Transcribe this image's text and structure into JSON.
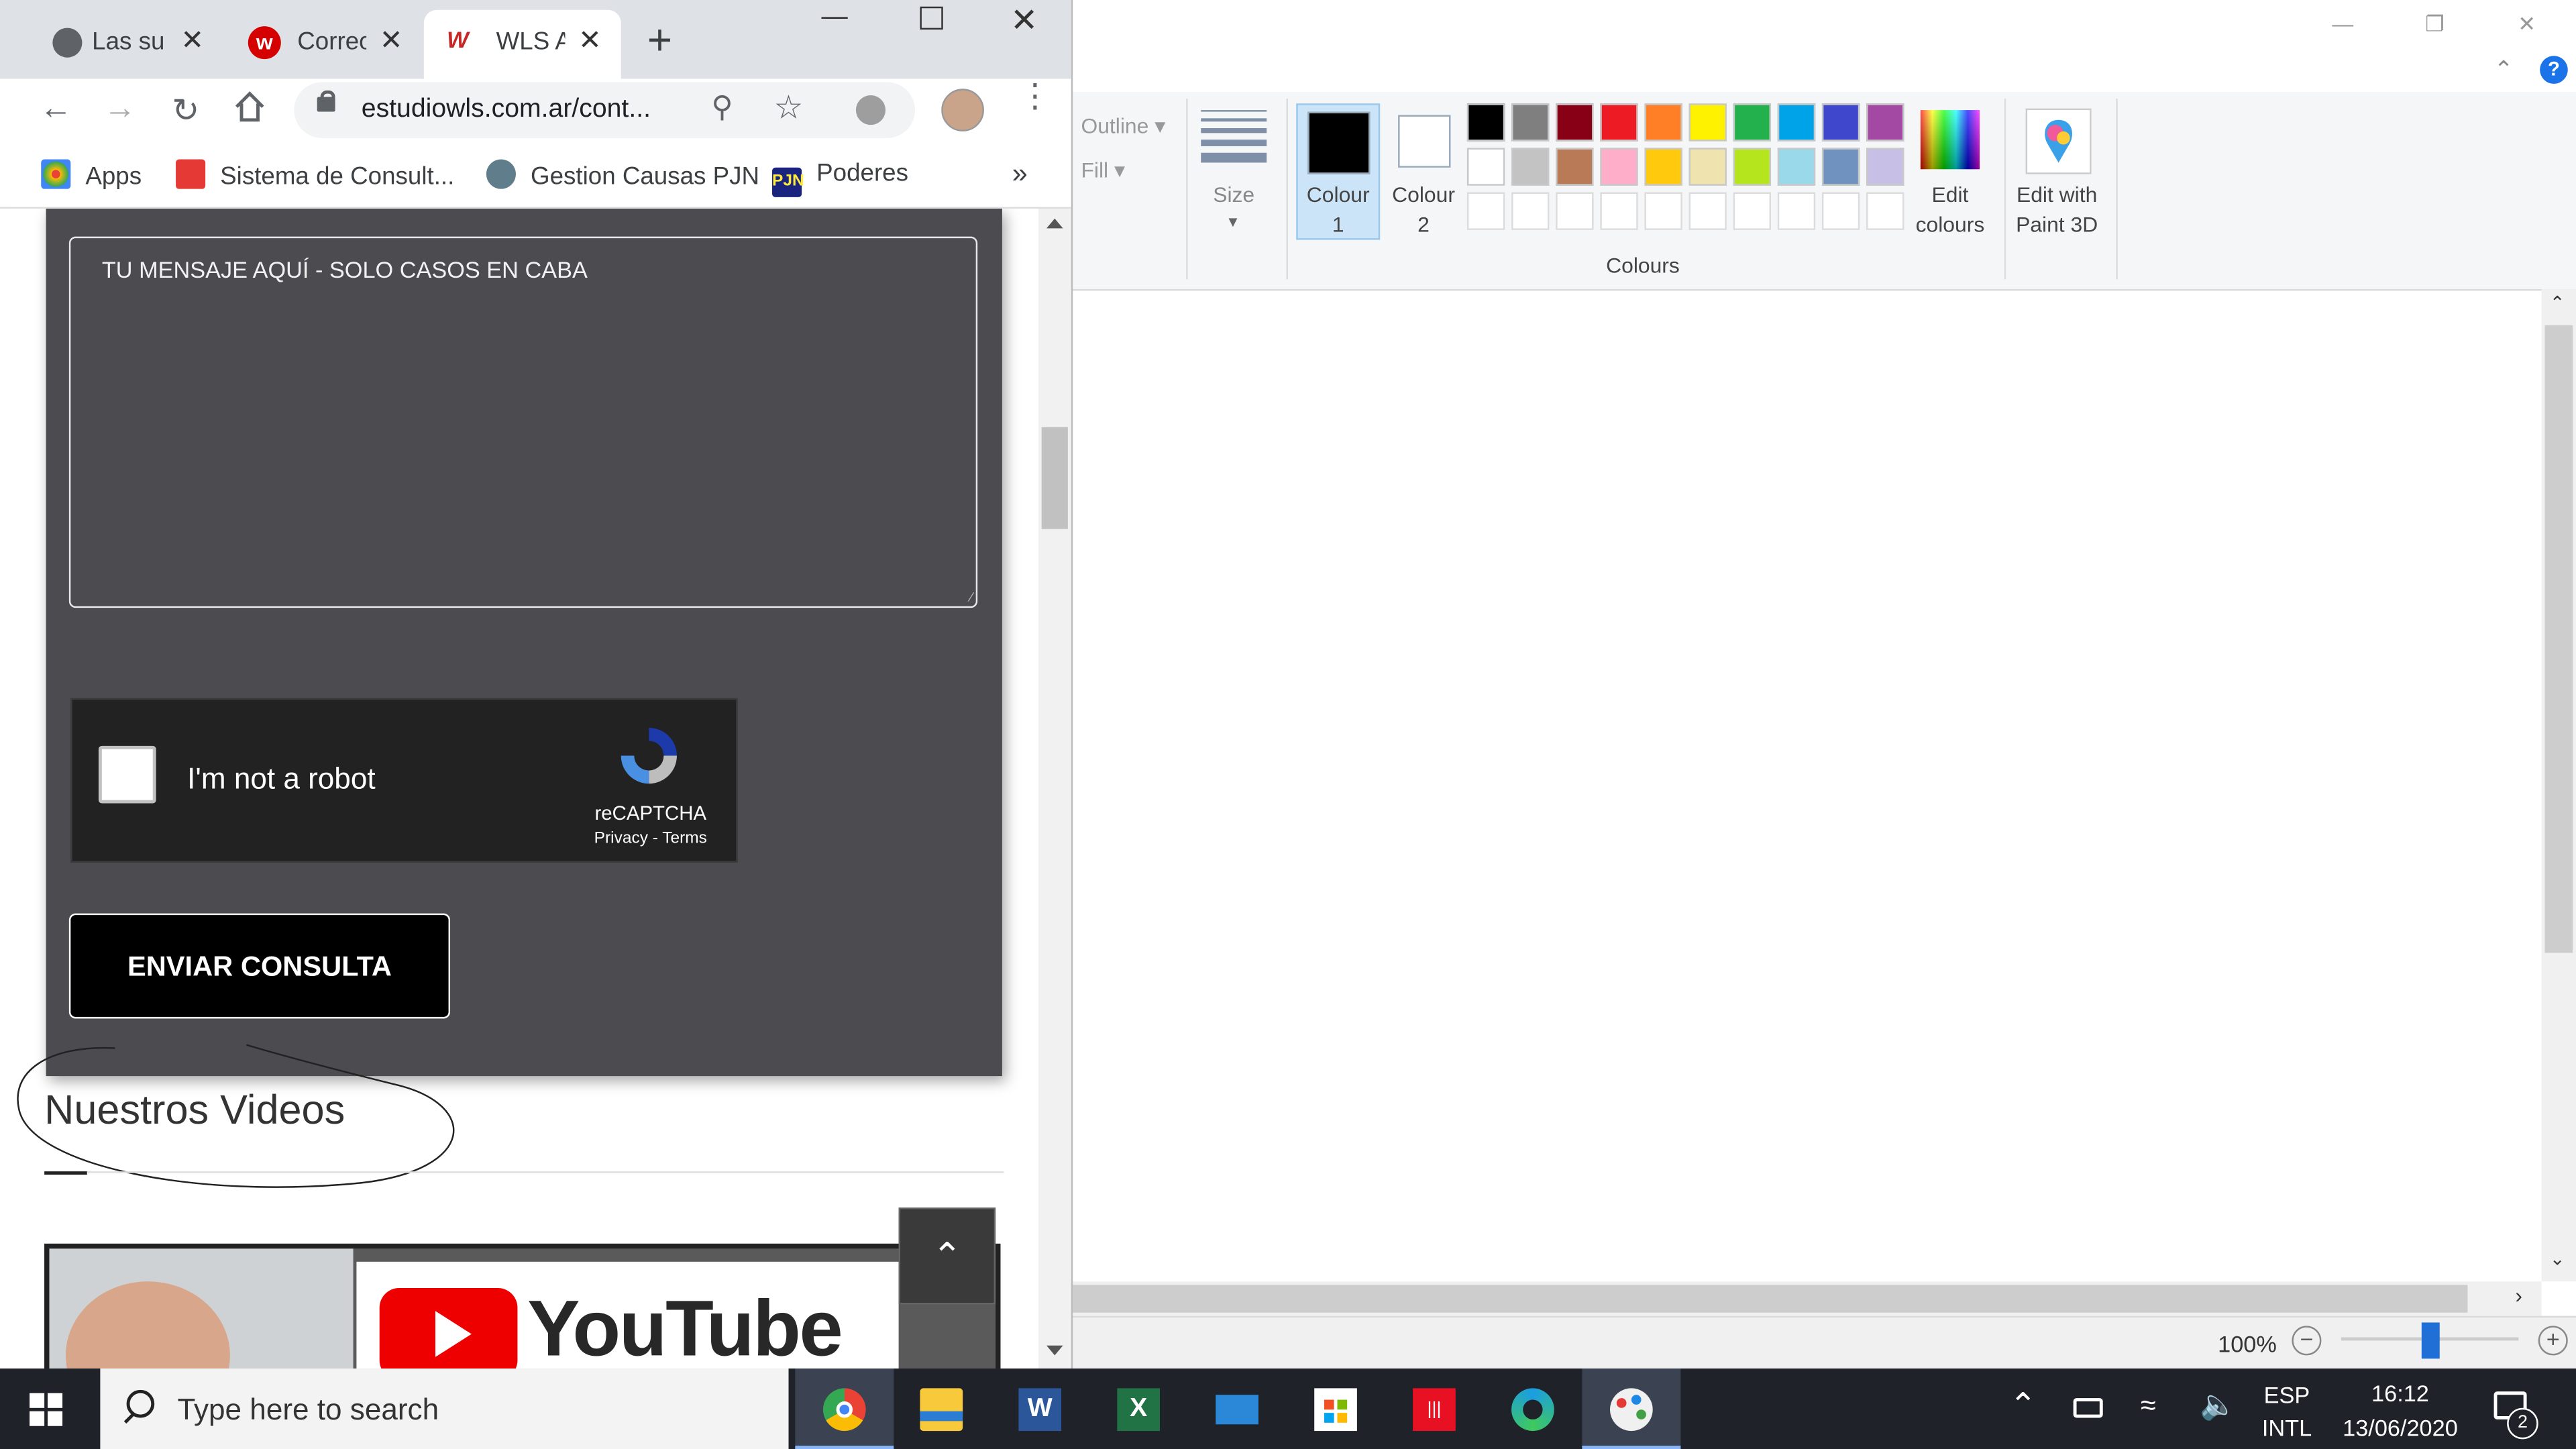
{
  "paint": {
    "ribbon": {
      "outline_label": "Outline",
      "fill_label": "Fill",
      "size_label": "Size",
      "colour1_label_line1": "Colour",
      "colour1_label_line2": "1",
      "colour2_label_line1": "Colour",
      "colour2_label_line2": "2",
      "edit_colours_line1": "Edit",
      "edit_colours_line2": "colours",
      "edit_paint3d_line1": "Edit with",
      "edit_paint3d_line2": "Paint 3D",
      "colours_group_label": "Colours",
      "palette_row1": [
        "#000000",
        "#7f7f7f",
        "#880015",
        "#ed1c24",
        "#ff7f27",
        "#fff200",
        "#22b14c",
        "#00a2e8",
        "#3f48cc",
        "#a349a4"
      ],
      "palette_row2": [
        "#ffffff",
        "#c3c3c3",
        "#b97a57",
        "#ffaec9",
        "#ffc90e",
        "#efe4b0",
        "#b5e61d",
        "#99d9ea",
        "#7092be",
        "#c8bfe7"
      ],
      "colour1": "#000000",
      "colour2": "#ffffff"
    },
    "status": {
      "zoom": "100%",
      "zoom_slider_value": 0.5
    }
  },
  "chrome": {
    "tabs": [
      {
        "label": "Las su",
        "active": false
      },
      {
        "label": "Correo",
        "active": false
      },
      {
        "label": "WLS A",
        "active": true
      }
    ],
    "url": "estudiowls.com.ar/cont...",
    "bookmarks": [
      {
        "label": "Apps"
      },
      {
        "label": "Sistema de Consult..."
      },
      {
        "label": "Gestion Causas PJN"
      },
      {
        "label": "Poderes"
      }
    ],
    "form": {
      "message_text": "TU MENSAJE AQUÍ - SOLO CASOS EN CABA",
      "recaptcha_label": "I'm not a robot",
      "recaptcha_brand": "reCAPTCHA",
      "recaptcha_links": "Privacy - Terms",
      "submit_label": "ENVIAR CONSULTA"
    },
    "videos_heading": "Nuestros Videos",
    "youtube_label": "YouTube"
  },
  "taskbar": {
    "search_placeholder": "Type here to search",
    "apps": [
      "chrome",
      "file-explorer",
      "word",
      "excel",
      "mail",
      "store",
      "app-red",
      "edge",
      "paint"
    ],
    "lang_line1": "ESP",
    "lang_line2": "INTL",
    "time": "16:12",
    "date": "13/06/2020",
    "notification_count": "2"
  }
}
